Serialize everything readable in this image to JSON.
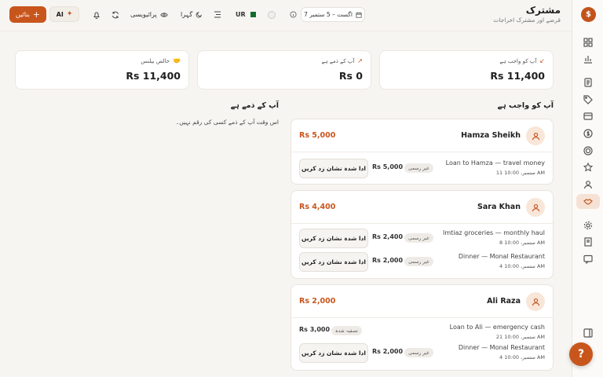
{
  "header": {
    "title": "مشترک",
    "subtitle": "قرضے اور مشترک اخراجات",
    "date_range": "7 اگست – 5 ستمبر",
    "lang": "UR",
    "density_label": "",
    "theme_label": "گہرا",
    "privacy_label": "پرائیویسی",
    "ai_label": "AI",
    "create_label": "بنائیں"
  },
  "summary": [
    {
      "label": "آپ کو واجب ہے",
      "value": "Rs 11,400",
      "icon": "arrow-down-left-icon"
    },
    {
      "label": "آپ کے ذمے ہے",
      "value": "Rs 0",
      "icon": "arrow-up-right-icon"
    },
    {
      "label": "خالص بیلنس",
      "value": "Rs 11,400",
      "icon": "handshake-icon"
    }
  ],
  "owed_to_you": {
    "title": "آپ کو واجب ہے",
    "people": [
      {
        "name": "Hamza Sheikh",
        "total": "Rs 5,000",
        "rows": [
          {
            "desc": "Loan to Hamza — travel money",
            "date": "11 ستمبر، 10:00 AM",
            "badge": "غیر رسمی",
            "amount": "Rs 5,000",
            "action": "ادا شدہ نشان زد کریں"
          }
        ]
      },
      {
        "name": "Sara Khan",
        "total": "Rs 4,400",
        "rows": [
          {
            "desc": "Imtiaz groceries — monthly haul",
            "date": "8 ستمبر، 10:00 AM",
            "badge": "غیر رسمی",
            "amount": "Rs 2,400",
            "action": "ادا شدہ نشان زد کریں"
          },
          {
            "desc": "Dinner — Monal Restaurant",
            "date": "4 ستمبر، 10:00 AM",
            "badge": "غیر رسمی",
            "amount": "Rs 2,000",
            "action": "ادا شدہ نشان زد کریں"
          }
        ]
      },
      {
        "name": "Ali Raza",
        "total": "Rs 2,000",
        "rows": [
          {
            "desc": "Loan to Ali — emergency cash",
            "date": "21 ستمبر، 10:00 AM",
            "badge": "تصفیہ شدہ",
            "amount": "Rs 3,000",
            "action": ""
          },
          {
            "desc": "Dinner — Monal Restaurant",
            "date": "4 ستمبر، 10:00 AM",
            "badge": "غیر رسمی",
            "amount": "Rs 2,000",
            "action": "ادا شدہ نشان زد کریں"
          }
        ]
      }
    ]
  },
  "you_owe": {
    "title": "آپ کے ذمے ہے",
    "empty": "اس وقت آپ کے ذمے کسی کی رقم نہیں۔"
  },
  "colors": {
    "accent": "#c8561c",
    "accent_light": "#f8e6d9",
    "background": "#f7f5f2"
  }
}
